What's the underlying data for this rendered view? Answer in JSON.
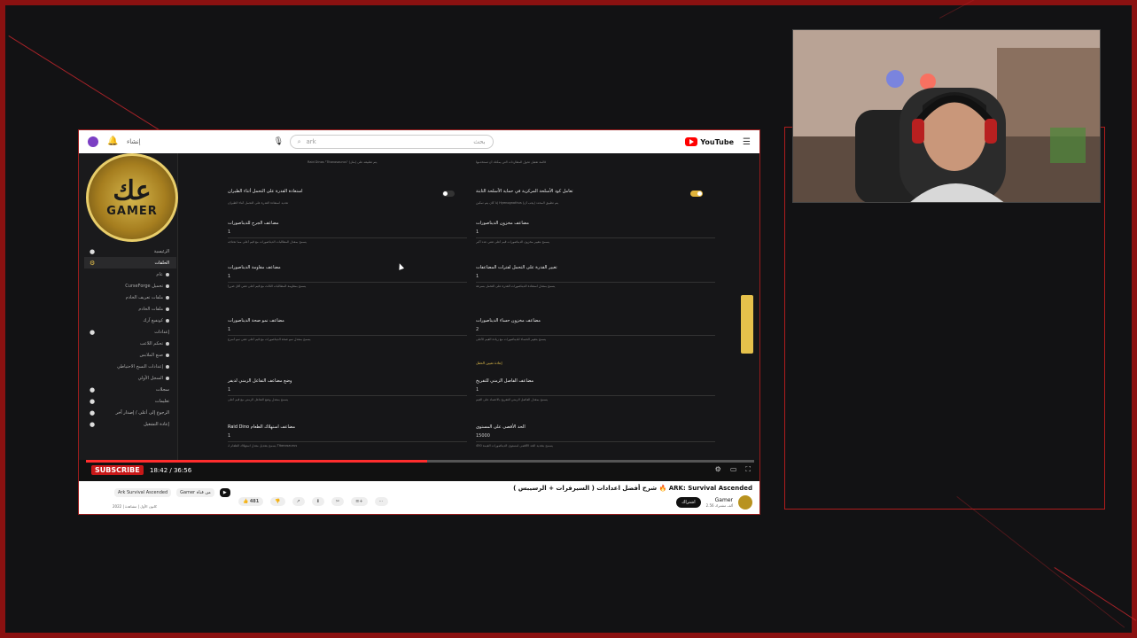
{
  "browser": {
    "create_label": "إنشاء",
    "search_query": "ark",
    "search_hint": "بحث",
    "logo_text": "YouTube"
  },
  "channel_badge": {
    "glyph": "عك",
    "name": "GAMER"
  },
  "sidebar": {
    "items": [
      {
        "label": "الرئيسية",
        "type": "item"
      },
      {
        "label": "الحلقات",
        "type": "active"
      },
      {
        "label": "عام",
        "type": "sub"
      },
      {
        "label": "CurseForge تحميل",
        "type": "sub"
      },
      {
        "label": "ملفات تعريف الخادم",
        "type": "sub"
      },
      {
        "label": "ملفات الخادم",
        "type": "sub"
      },
      {
        "label": "كونفيغ آرك",
        "type": "sub"
      },
      {
        "label": "إعدادات",
        "type": "item"
      },
      {
        "label": "تحكم اللاعب",
        "type": "sub"
      },
      {
        "label": "صنع الملابس",
        "type": "sub"
      },
      {
        "label": "إعدادات النسخ الاحتياطي",
        "type": "sub"
      },
      {
        "label": "السجل الأولي",
        "type": "sub"
      },
      {
        "label": "سجلات",
        "type": "item"
      },
      {
        "label": "تعليمات",
        "type": "item"
      },
      {
        "label": "الرجوع إلى أعلى / إصدار آخر",
        "type": "item"
      },
      {
        "label": "إعادة التشغيل",
        "type": "item"
      }
    ]
  },
  "settings": {
    "top_desc_left": "Raid Dinos \"Titanosaurus\" (مثل) يتم تطبيقه على",
    "top_desc_right": "قائمة تفعيل تحول المطاردات التي يمكنك أن تستخدمها",
    "s1_left_label": "استعادة القدرة على التحمل أثناء الطيران",
    "s1_left_desc": "تحديد استعادة القدرة على التحمل أثناء الطيران",
    "s1_right_label": "تعامل كود الأسلحة المركزية في حماية الأسلحة الثابتة",
    "s1_right_desc": "إذا كان يتم تمكين Hyenognathus (يجب أن) يتم تطبيق المحدد",
    "s2_left_label": "مضاعف الجرح للديناصورات",
    "s2_left_val": "1",
    "s2_left_desc": "يسمح بمعدل المطالبات الديناصورات مع قيم أعلى مما تحتاجه",
    "s2_right_label": "مضاعف مخزون الديناصورات",
    "s2_right_val": "1",
    "s2_right_desc": "يسمح بتغيير مخزون الديناصورات قيم أعلى تعني عدد أكبر",
    "s3_left_label": "مضاعف مقاومة الديناصورات",
    "s3_left_val": "1",
    "s3_left_desc": "يسمح بمقاومة المطالبات الثالث مع قيم أعلى تعني أقل ضرراً",
    "s3_right_label": "تغيير القدرة على التحمل لفترات المضاعفات",
    "s3_right_val": "1",
    "s3_right_desc": "يسمح بمعدل استعادة الديناصورات القدرة على التحمل بسرعة",
    "s4_left_label": "مضاعف نمو صحة الديناصورات",
    "s4_left_val": "1",
    "s4_left_desc": "يسمح بمعدل نمو صحة الديناصورات مع قيم أعلى تعني نمو أسرع",
    "s4_right_label": "مضاعف مخزون حساء الديناصورات",
    "s4_right_val": "2",
    "s4_right_desc": "يسمح بتغيير الحساء للديناصورات مع زيادة القيم الأعلى",
    "s4_link": "إعادة تعيين الحقل",
    "s5_left_label": "وضع مضاعف التفاعل الزمني لديفر",
    "s5_left_val": "1",
    "s5_left_desc": "يسمح بمعدل وضع التفاعل الزمني مع قيم أعلى",
    "s5_right_label": "مضاعف الفاصل الزمني للتفريخ",
    "s5_right_val": "1",
    "s5_right_desc": "يسمح بمعدل الفاصل الزمني للتفريخ بالاعتماد على القيم",
    "s6_left_label": "Raid Dino مضاعف استهلاك الطعام",
    "s6_left_val": "1",
    "s6_left_desc": "يسمح بتعديل معدل استهلاك الطعام لـ Titanosaurus",
    "s6_right_label": "الحد الأقصى على المستوى",
    "s6_right_val": "15000",
    "s6_right_desc": "يسمح بتحديد الحد الأقصى لمستوى الديناصورات القيمة 450"
  },
  "player": {
    "subscribe_overlay": "SUBSCRIBE",
    "time": "18:42 / 36:56",
    "progress": 0.51
  },
  "video_info": {
    "title": "شرح أفضل اعدادات ( السيرفرات + الرسيبس ) 🔥 ARK: Survival Ascended",
    "channel_name": "Gamer",
    "channel_subs": "2.56 ألف مشترك",
    "subscribe_label": "اشتراك",
    "likes": "481",
    "tag1": "Ark Survival Ascended",
    "tag2": "Gamer من قناة",
    "date": "2022 | كانون الأول | مشاهدة"
  },
  "colors": {
    "accent_red": "#c0262b",
    "gold": "#e6c14b",
    "frame": "#8a1111"
  }
}
